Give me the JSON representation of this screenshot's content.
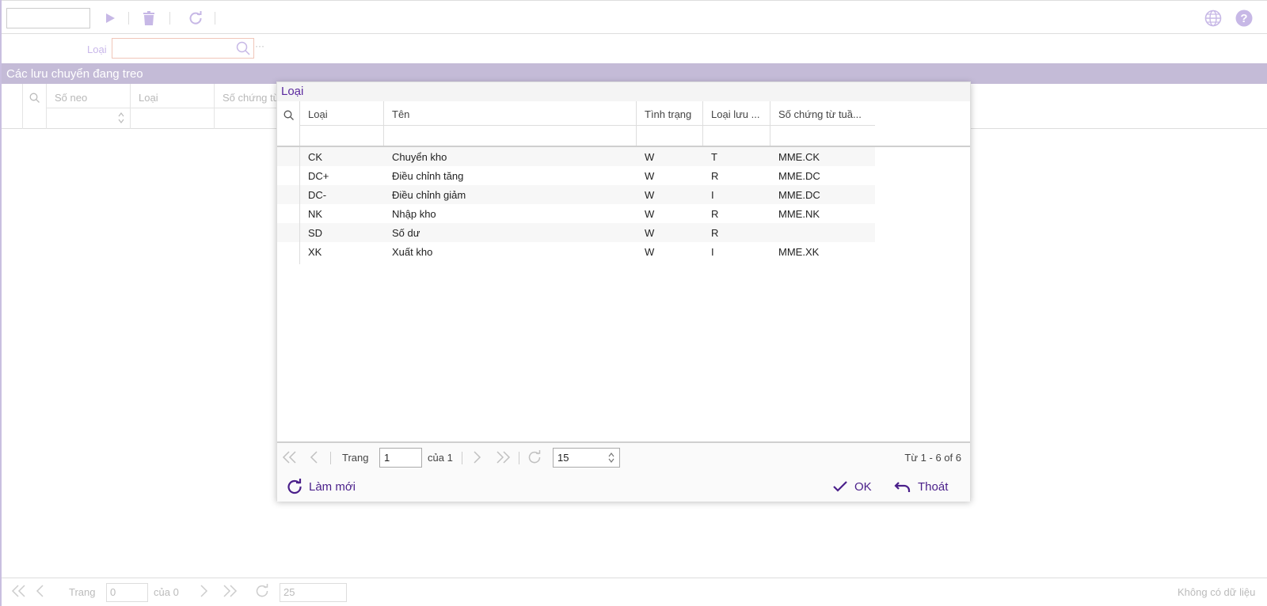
{
  "toolbar": {
    "icons": [
      "play-icon",
      "trash-icon",
      "refresh-icon",
      "globe-icon",
      "help-icon"
    ]
  },
  "filter": {
    "label": "Loại",
    "value": ""
  },
  "section": {
    "title": "Các lưu chuyển đang treo"
  },
  "background_grid": {
    "columns": [
      "Số neo",
      "Loại",
      "Số chứng từ"
    ]
  },
  "bottom_pager": {
    "page_label": "Trang",
    "page_value": "0",
    "of_label": "của 0",
    "page_size": "25",
    "status": "Không có dữ liệu"
  },
  "dialog": {
    "title": "Loại",
    "columns": [
      "Loại",
      "Tên",
      "Tình trạng",
      "Loại lưu ...",
      "Số chứng từ tuầ..."
    ],
    "rows": [
      {
        "loai": "CK",
        "ten": "Chuyển kho",
        "tinh_trang": "W",
        "loai_luu": "T",
        "so_chung_tu": "MME.CK"
      },
      {
        "loai": "DC+",
        "ten": "Điều chỉnh tăng",
        "tinh_trang": "W",
        "loai_luu": "R",
        "so_chung_tu": "MME.DC"
      },
      {
        "loai": "DC-",
        "ten": "Điều chỉnh giảm",
        "tinh_trang": "W",
        "loai_luu": "I",
        "so_chung_tu": "MME.DC"
      },
      {
        "loai": "NK",
        "ten": "Nhập kho",
        "tinh_trang": "W",
        "loai_luu": "R",
        "so_chung_tu": "MME.NK"
      },
      {
        "loai": "SD",
        "ten": "Số dư",
        "tinh_trang": "W",
        "loai_luu": "R",
        "so_chung_tu": ""
      },
      {
        "loai": "XK",
        "ten": "Xuất kho",
        "tinh_trang": "W",
        "loai_luu": "I",
        "so_chung_tu": "MME.XK"
      }
    ],
    "pager": {
      "page_label": "Trang",
      "page_value": "1",
      "of_label": "của 1",
      "page_size": "15",
      "status": "Từ 1 - 6 of 6"
    },
    "footer": {
      "refresh_label": "Làm mới",
      "ok_label": "OK",
      "exit_label": "Thoát"
    }
  },
  "colors": {
    "accent": "#4a1f8a",
    "section_bg": "#c4bbd7",
    "icon_light": "#c7b8e6"
  }
}
